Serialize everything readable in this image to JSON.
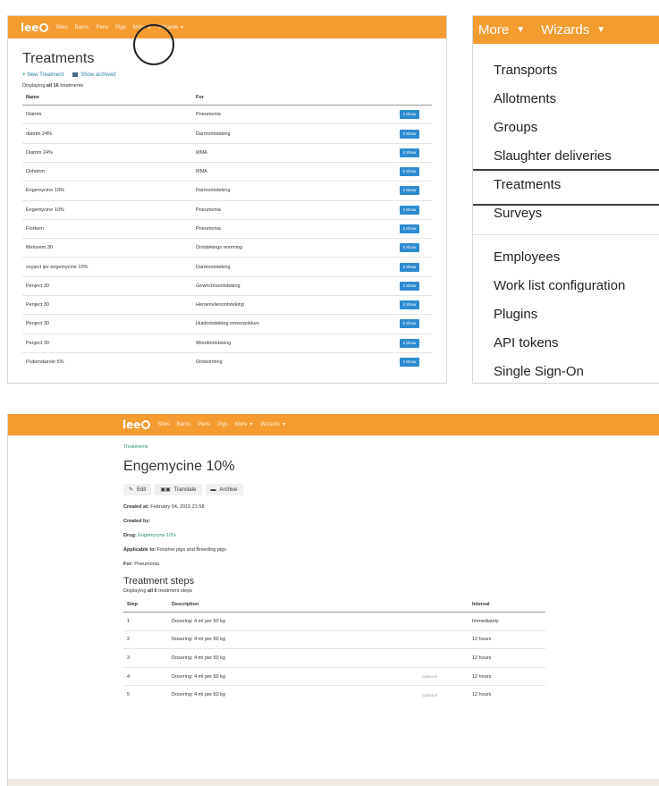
{
  "brand": {
    "logo": "lee",
    "accent": "#f49b32"
  },
  "list_page": {
    "nav": {
      "items": [
        "Sites",
        "Barns",
        "Pens",
        "Pigs",
        "More",
        "Wizards"
      ]
    },
    "title": "Treatments",
    "actions": {
      "new": "New Treatment",
      "archived": "Show archived"
    },
    "count": {
      "prefix": "Displaying",
      "strong": "all 16",
      "suffix": "treatments"
    },
    "columns": {
      "name": "Name",
      "for": "For"
    },
    "show_label": "Show",
    "rows": [
      {
        "name": "Diatrim",
        "for": "Pneumonia"
      },
      {
        "name": "diatrim 24%",
        "for": "Darmontsteking"
      },
      {
        "name": "Diatrim 24%",
        "for": "MMA"
      },
      {
        "name": "Dofatrim",
        "for": "MMA"
      },
      {
        "name": "Engemycine 10%",
        "for": "Darmontsteking"
      },
      {
        "name": "Engemycine 10%",
        "for": "Pneumonia"
      },
      {
        "name": "Florkem",
        "for": "Pneumonia"
      },
      {
        "name": "Meloxem 30",
        "for": "Ontstekings remming"
      },
      {
        "name": "oxyject ipv engemycine 10%",
        "for": "Darmontsteking"
      },
      {
        "name": "Penject 30",
        "for": "Gewrichtsontsteking"
      },
      {
        "name": "Penject 30",
        "for": "Hersenvliesontsteking"
      },
      {
        "name": "Penject 30",
        "for": "Huidontsteking smeerpokken"
      },
      {
        "name": "Penject 30",
        "for": "Wondontsteking"
      },
      {
        "name": "Flubendazole 5%",
        "for": "Ontworming"
      }
    ]
  },
  "menu_zoom": {
    "bar": {
      "more": "More",
      "wizards": "Wizards"
    },
    "group1": [
      "Transports",
      "Allotments",
      "Groups",
      "Slaughter deliveries",
      "Treatments",
      "Surveys"
    ],
    "group2": [
      "Employees",
      "Work list configuration",
      "Plugins",
      "API tokens",
      "Single Sign-On"
    ]
  },
  "detail_page": {
    "nav": {
      "items": [
        "Sites",
        "Barns",
        "Pens",
        "Pigs",
        "More",
        "Wizards"
      ]
    },
    "breadcrumb": "Treatments",
    "title": "Engemycine 10%",
    "buttons": {
      "edit": "Edit",
      "translate": "Translate",
      "archive": "Archive"
    },
    "meta": {
      "created_at_label": "Created at:",
      "created_at": "February 04, 2015 21:58",
      "created_by_label": "Created by:",
      "drug_label": "Drug:",
      "drug": "Engemycine 10%",
      "applicable_label": "Applicable to:",
      "applicable": "Finisher pigs and Breeding pigs",
      "for_label": "For:",
      "for": "Pneumonia"
    },
    "steps_title": "Treatment steps",
    "steps_count": {
      "prefix": "Displaying",
      "strong": "all 5",
      "suffix": "treatment steps"
    },
    "columns": {
      "step": "Step",
      "description": "Description",
      "interval": "Interval"
    },
    "steps": [
      {
        "step": "1",
        "description": "Dosering: 4 ml per 50 kg",
        "optional": "",
        "interval": "Immediately"
      },
      {
        "step": "2",
        "description": "Dosering: 4 ml per 50 kg",
        "optional": "",
        "interval": "12 hours"
      },
      {
        "step": "3",
        "description": "Dosering: 4 ml per 50 kg",
        "optional": "",
        "interval": "12 hours"
      },
      {
        "step": "4",
        "description": "Dosering: 4 ml per 50 kg",
        "optional": "Optional",
        "interval": "12 hours"
      },
      {
        "step": "5",
        "description": "Dosering: 4 ml per 50 kg",
        "optional": "Optional",
        "interval": "12 hours"
      }
    ]
  }
}
